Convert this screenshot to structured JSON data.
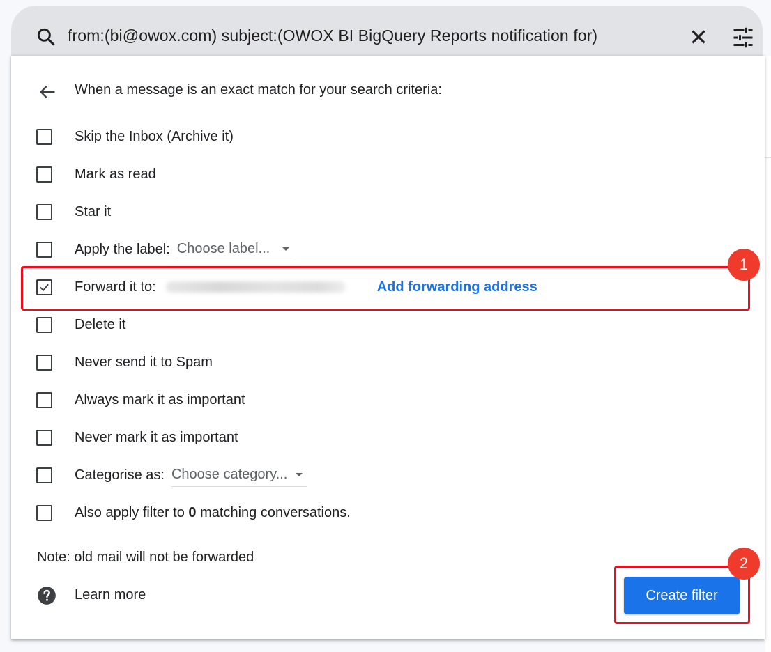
{
  "search": {
    "query": "from:(bi@owox.com) subject:(OWOX BI BigQuery Reports notification for)",
    "icons": {
      "search": "search-icon",
      "clear": "close-icon",
      "options": "tune-icon"
    }
  },
  "dialog": {
    "title": "When a message is an exact match for your search criteria:",
    "options": {
      "skip_inbox": {
        "label": "Skip the Inbox (Archive it)",
        "checked": false
      },
      "mark_read": {
        "label": "Mark as read",
        "checked": false
      },
      "star": {
        "label": "Star it",
        "checked": false
      },
      "apply_label": {
        "label": "Apply the label:",
        "select_value": "Choose label...",
        "checked": false
      },
      "forward": {
        "label": "Forward it to:",
        "link": "Add forwarding address",
        "checked": true
      },
      "delete": {
        "label": "Delete it",
        "checked": false
      },
      "never_spam": {
        "label": "Never send it to Spam",
        "checked": false
      },
      "always_important": {
        "label": "Always mark it as important",
        "checked": false
      },
      "never_important": {
        "label": "Never mark it as important",
        "checked": false
      },
      "categorise": {
        "label": "Categorise as:",
        "select_value": "Choose category...",
        "checked": false
      },
      "apply_existing": {
        "label_before": "Also apply filter to",
        "count": "0",
        "label_after": "matching conversations.",
        "checked": false
      }
    },
    "note": "Note: old mail will not be forwarded",
    "learn_more": "Learn more",
    "create_button": "Create filter"
  },
  "annotations": {
    "badge_1": "1",
    "badge_2": "2",
    "color": "#e8101e"
  },
  "colors": {
    "accent": "#1a73e8",
    "search_bar": "#e1e3e6",
    "annotation_badge": "#ef3b2c"
  }
}
